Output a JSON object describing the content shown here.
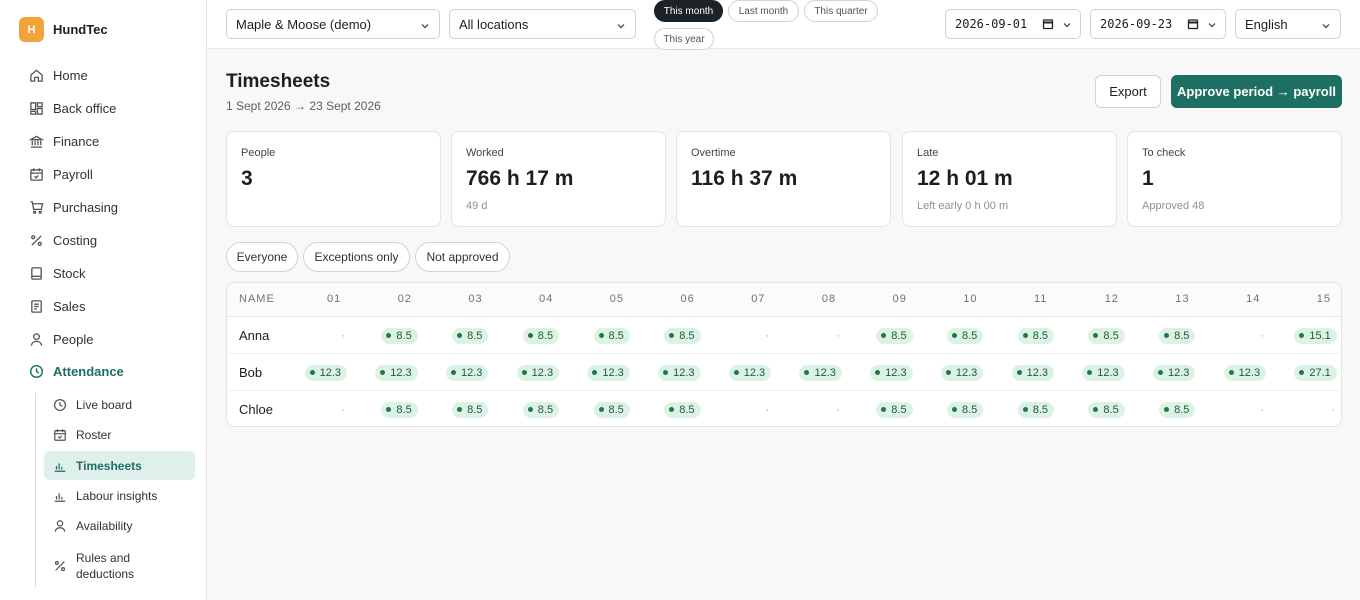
{
  "brand": {
    "logo_letter": "H",
    "name": "HundTec"
  },
  "nav": [
    {
      "label": "Home",
      "icon": "home-icon"
    },
    {
      "label": "Back office",
      "icon": "grid-icon"
    },
    {
      "label": "Finance",
      "icon": "bank-icon"
    },
    {
      "label": "Payroll",
      "icon": "calendar-icon"
    },
    {
      "label": "Purchasing",
      "icon": "cart-icon"
    },
    {
      "label": "Costing",
      "icon": "percent-icon"
    },
    {
      "label": "Stock",
      "icon": "box-icon"
    },
    {
      "label": "Sales",
      "icon": "receipt-icon"
    },
    {
      "label": "People",
      "icon": "person-icon"
    },
    {
      "label": "Attendance",
      "icon": "clock-icon",
      "active": true
    }
  ],
  "subnav": [
    {
      "label": "Live board",
      "icon": "clock-icon"
    },
    {
      "label": "Roster",
      "icon": "calendar-icon"
    },
    {
      "label": "Timesheets",
      "icon": "bar-chart-icon",
      "active": true
    },
    {
      "label": "Labour insights",
      "icon": "bar-chart-icon"
    },
    {
      "label": "Availability",
      "icon": "person-icon"
    },
    {
      "label": "Rules and deductions",
      "icon": "percent-icon"
    }
  ],
  "topbar": {
    "company": "Maple & Moose (demo)",
    "location": "All locations",
    "periods": [
      "This month",
      "Last month",
      "This quarter",
      "This year"
    ],
    "active_period": "This month",
    "date_from": "2026-09-01",
    "date_to": "2026-09-23",
    "language": "English"
  },
  "page": {
    "title": "Timesheets",
    "subtitle": "1 Sept 2026 → 23 Sept 2026",
    "export_label": "Export",
    "approve_label": "Approve period → payroll"
  },
  "stats": [
    {
      "label": "People",
      "value": "3",
      "note": ""
    },
    {
      "label": "Worked",
      "value": "766 h 17 m",
      "note": "49 d"
    },
    {
      "label": "Overtime",
      "value": "116 h 37 m",
      "note": ""
    },
    {
      "label": "Late",
      "value": "12 h 01 m",
      "note": "Left early 0 h 00 m"
    },
    {
      "label": "To check",
      "value": "1",
      "note": "Approved 48"
    }
  ],
  "filters": [
    "Everyone",
    "Exceptions only",
    "Not approved"
  ],
  "grid": {
    "name_header": "NAME",
    "days": [
      "01",
      "02",
      "03",
      "04",
      "05",
      "06",
      "07",
      "08",
      "09",
      "10",
      "11",
      "12",
      "13",
      "14",
      "15"
    ],
    "rows": [
      {
        "name": "Anna",
        "values": [
          "·",
          "8.5",
          "8.5",
          "8.5",
          "8.5",
          "8.5",
          "·",
          "·",
          "8.5",
          "8.5",
          "8.5",
          "8.5",
          "8.5",
          "·",
          "15.1"
        ]
      },
      {
        "name": "Bob",
        "values": [
          "12.3",
          "12.3",
          "12.3",
          "12.3",
          "12.3",
          "12.3",
          "12.3",
          "12.3",
          "12.3",
          "12.3",
          "12.3",
          "12.3",
          "12.3",
          "12.3",
          "27.1"
        ]
      },
      {
        "name": "Chloe",
        "values": [
          "·",
          "8.5",
          "8.5",
          "8.5",
          "8.5",
          "8.5",
          "·",
          "·",
          "8.5",
          "8.5",
          "8.5",
          "8.5",
          "8.5",
          "·",
          "·"
        ]
      }
    ]
  },
  "colors": {
    "accent": "#1d6e63",
    "chip_bg": "#dcf2e4",
    "chip_text": "#1f5a3a",
    "active_pill": "#1b2228",
    "brand_logo": "#f2a33a"
  }
}
